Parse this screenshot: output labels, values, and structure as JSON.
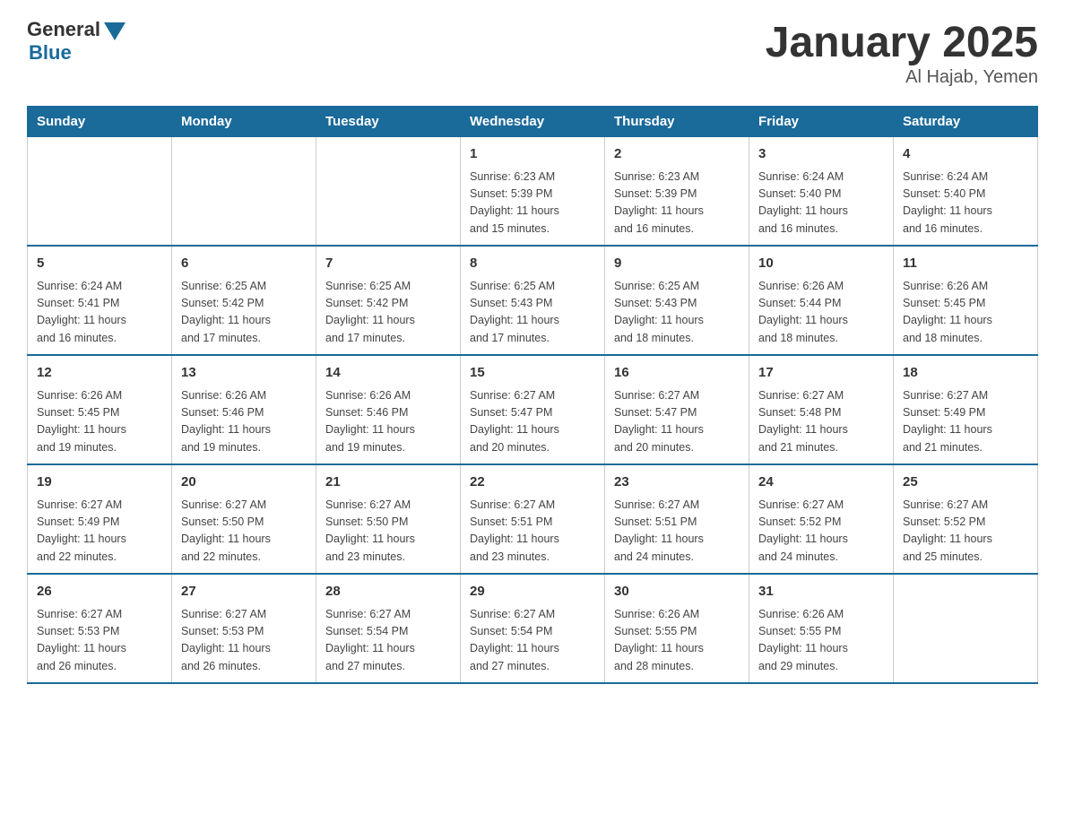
{
  "header": {
    "logo_general": "General",
    "logo_blue": "Blue",
    "title": "January 2025",
    "subtitle": "Al Hajab, Yemen"
  },
  "days_of_week": [
    "Sunday",
    "Monday",
    "Tuesday",
    "Wednesday",
    "Thursday",
    "Friday",
    "Saturday"
  ],
  "weeks": [
    [
      {
        "day": "",
        "info": ""
      },
      {
        "day": "",
        "info": ""
      },
      {
        "day": "",
        "info": ""
      },
      {
        "day": "1",
        "info": "Sunrise: 6:23 AM\nSunset: 5:39 PM\nDaylight: 11 hours\nand 15 minutes."
      },
      {
        "day": "2",
        "info": "Sunrise: 6:23 AM\nSunset: 5:39 PM\nDaylight: 11 hours\nand 16 minutes."
      },
      {
        "day": "3",
        "info": "Sunrise: 6:24 AM\nSunset: 5:40 PM\nDaylight: 11 hours\nand 16 minutes."
      },
      {
        "day": "4",
        "info": "Sunrise: 6:24 AM\nSunset: 5:40 PM\nDaylight: 11 hours\nand 16 minutes."
      }
    ],
    [
      {
        "day": "5",
        "info": "Sunrise: 6:24 AM\nSunset: 5:41 PM\nDaylight: 11 hours\nand 16 minutes."
      },
      {
        "day": "6",
        "info": "Sunrise: 6:25 AM\nSunset: 5:42 PM\nDaylight: 11 hours\nand 17 minutes."
      },
      {
        "day": "7",
        "info": "Sunrise: 6:25 AM\nSunset: 5:42 PM\nDaylight: 11 hours\nand 17 minutes."
      },
      {
        "day": "8",
        "info": "Sunrise: 6:25 AM\nSunset: 5:43 PM\nDaylight: 11 hours\nand 17 minutes."
      },
      {
        "day": "9",
        "info": "Sunrise: 6:25 AM\nSunset: 5:43 PM\nDaylight: 11 hours\nand 18 minutes."
      },
      {
        "day": "10",
        "info": "Sunrise: 6:26 AM\nSunset: 5:44 PM\nDaylight: 11 hours\nand 18 minutes."
      },
      {
        "day": "11",
        "info": "Sunrise: 6:26 AM\nSunset: 5:45 PM\nDaylight: 11 hours\nand 18 minutes."
      }
    ],
    [
      {
        "day": "12",
        "info": "Sunrise: 6:26 AM\nSunset: 5:45 PM\nDaylight: 11 hours\nand 19 minutes."
      },
      {
        "day": "13",
        "info": "Sunrise: 6:26 AM\nSunset: 5:46 PM\nDaylight: 11 hours\nand 19 minutes."
      },
      {
        "day": "14",
        "info": "Sunrise: 6:26 AM\nSunset: 5:46 PM\nDaylight: 11 hours\nand 19 minutes."
      },
      {
        "day": "15",
        "info": "Sunrise: 6:27 AM\nSunset: 5:47 PM\nDaylight: 11 hours\nand 20 minutes."
      },
      {
        "day": "16",
        "info": "Sunrise: 6:27 AM\nSunset: 5:47 PM\nDaylight: 11 hours\nand 20 minutes."
      },
      {
        "day": "17",
        "info": "Sunrise: 6:27 AM\nSunset: 5:48 PM\nDaylight: 11 hours\nand 21 minutes."
      },
      {
        "day": "18",
        "info": "Sunrise: 6:27 AM\nSunset: 5:49 PM\nDaylight: 11 hours\nand 21 minutes."
      }
    ],
    [
      {
        "day": "19",
        "info": "Sunrise: 6:27 AM\nSunset: 5:49 PM\nDaylight: 11 hours\nand 22 minutes."
      },
      {
        "day": "20",
        "info": "Sunrise: 6:27 AM\nSunset: 5:50 PM\nDaylight: 11 hours\nand 22 minutes."
      },
      {
        "day": "21",
        "info": "Sunrise: 6:27 AM\nSunset: 5:50 PM\nDaylight: 11 hours\nand 23 minutes."
      },
      {
        "day": "22",
        "info": "Sunrise: 6:27 AM\nSunset: 5:51 PM\nDaylight: 11 hours\nand 23 minutes."
      },
      {
        "day": "23",
        "info": "Sunrise: 6:27 AM\nSunset: 5:51 PM\nDaylight: 11 hours\nand 24 minutes."
      },
      {
        "day": "24",
        "info": "Sunrise: 6:27 AM\nSunset: 5:52 PM\nDaylight: 11 hours\nand 24 minutes."
      },
      {
        "day": "25",
        "info": "Sunrise: 6:27 AM\nSunset: 5:52 PM\nDaylight: 11 hours\nand 25 minutes."
      }
    ],
    [
      {
        "day": "26",
        "info": "Sunrise: 6:27 AM\nSunset: 5:53 PM\nDaylight: 11 hours\nand 26 minutes."
      },
      {
        "day": "27",
        "info": "Sunrise: 6:27 AM\nSunset: 5:53 PM\nDaylight: 11 hours\nand 26 minutes."
      },
      {
        "day": "28",
        "info": "Sunrise: 6:27 AM\nSunset: 5:54 PM\nDaylight: 11 hours\nand 27 minutes."
      },
      {
        "day": "29",
        "info": "Sunrise: 6:27 AM\nSunset: 5:54 PM\nDaylight: 11 hours\nand 27 minutes."
      },
      {
        "day": "30",
        "info": "Sunrise: 6:26 AM\nSunset: 5:55 PM\nDaylight: 11 hours\nand 28 minutes."
      },
      {
        "day": "31",
        "info": "Sunrise: 6:26 AM\nSunset: 5:55 PM\nDaylight: 11 hours\nand 29 minutes."
      },
      {
        "day": "",
        "info": ""
      }
    ]
  ]
}
